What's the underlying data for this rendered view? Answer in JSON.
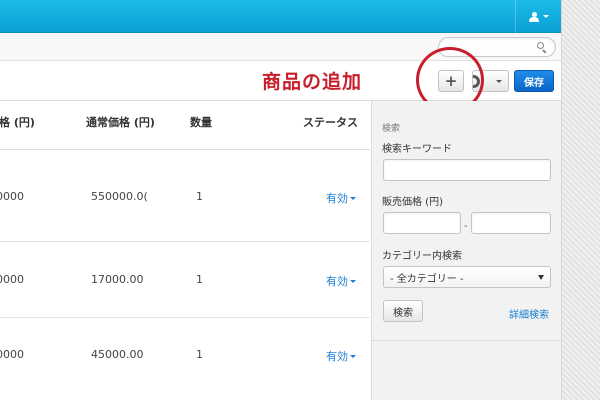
{
  "annotation": {
    "text": "商品の追加"
  },
  "header": {
    "save_label": "保存"
  },
  "table": {
    "columns": [
      "価格 (円)",
      "通常価格 (円)",
      "数量",
      "ステータス"
    ],
    "rows": [
      {
        "price": "0000",
        "regular_price": "550000.0(",
        "quantity": "1",
        "status": "有効"
      },
      {
        "price": "0000",
        "regular_price": "17000.00",
        "quantity": "1",
        "status": "有効"
      },
      {
        "price": "0000",
        "regular_price": "45000.00",
        "quantity": "1",
        "status": "有効"
      }
    ]
  },
  "side": {
    "title": "検索",
    "keyword_label": "検索キーワード",
    "price_label": "販売価格 (円)",
    "range_sep": "-",
    "category_label": "カテゴリー内検索",
    "category_selected": "- 全カテゴリー -",
    "search_button": "検索",
    "advanced_link": "詳細検索"
  },
  "colors": {
    "topbar": "#0a9fd3",
    "accent_red": "#c81d2a",
    "link_blue": "#1a7fd3",
    "primary_button": "#0b64c6"
  },
  "icons": [
    "user-icon",
    "search-icon",
    "plus-icon",
    "gear-icon"
  ]
}
